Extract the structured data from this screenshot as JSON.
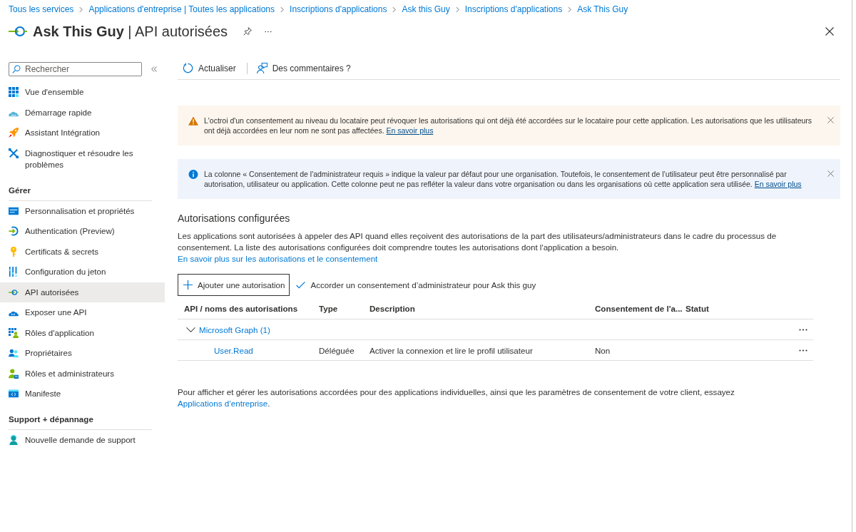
{
  "breadcrumb": [
    {
      "label": "Tous les services"
    },
    {
      "label": "Applications d'entreprise | Toutes les applications"
    },
    {
      "label": "Inscriptions d'applications"
    },
    {
      "label": "Ask this Guy"
    },
    {
      "label": "Inscriptions d'applications"
    },
    {
      "label": "Ask This Guy"
    }
  ],
  "header": {
    "title": "**Ask This Guy** | API autorisées"
  },
  "sidebar": {
    "search": {
      "placeholder": "Rechercher"
    },
    "sections": [
      {
        "items": [
          {
            "kind": "overview",
            "label": "Vue d'ensemble",
            "selected": false
          },
          {
            "kind": "quickstart",
            "label": "Démarrage rapide",
            "selected": false
          },
          {
            "kind": "integration",
            "label": "Assistant Intégration",
            "selected": false
          },
          {
            "kind": "diagnose",
            "label": "Diagnostiquer et résoudre les problèmes",
            "selected": false
          }
        ]
      },
      {
        "heading": "Gérer",
        "items": [
          {
            "kind": "branding",
            "label": "Personnalisation et propriétés",
            "selected": false
          },
          {
            "kind": "authentication",
            "label": "Authentication (Preview)",
            "selected": false
          },
          {
            "kind": "certificates",
            "label": "Certificats & secrets",
            "selected": false
          },
          {
            "kind": "token",
            "label": "Configuration du jeton",
            "selected": false
          },
          {
            "kind": "api",
            "label": "API autorisées",
            "selected": true
          },
          {
            "kind": "expose",
            "label": "Exposer une API",
            "selected": false
          },
          {
            "kind": "app-roles",
            "label": "Rôles d'application",
            "selected": false
          },
          {
            "kind": "owners",
            "label": "Propriétaires",
            "selected": false
          },
          {
            "kind": "roles",
            "label": "Rôles et administrateurs",
            "selected": false
          },
          {
            "kind": "manifest",
            "label": "Manifeste",
            "selected": false
          }
        ]
      },
      {
        "heading": "Support + dépannage",
        "items": [
          {
            "kind": "support",
            "label": "Nouvelle demande de support",
            "selected": false
          }
        ]
      }
    ]
  },
  "toolbar": [
    {
      "kind": "refresh",
      "label": "Actualiser"
    },
    {
      "kind": "feedback",
      "label": "Des commentaires ?"
    }
  ],
  "banners": [
    {
      "kind": "warning",
      "text": "L'octroi d'un consentement au niveau du locataire peut révoquer les autorisations qui ont déjà été accordées sur le locataire pour cette application. Les autorisations que les utilisateurs ont déjà accordées en leur nom ne sont pas affectées.",
      "link": "En savoir plus"
    },
    {
      "kind": "info",
      "text": "La colonne « Consentement de l'administrateur requis » indique la valeur par défaut pour une organisation. Toutefois, le consentement de l’utilisateur peut être personnalisé par autorisation, utilisateur ou application. Cette colonne peut ne pas refléter la valeur dans votre organisation ou dans les organisations où cette application sera utilisée.",
      "link": "En savoir plus"
    }
  ],
  "configured": {
    "title": "Autorisations configurées",
    "description": "Les applications sont autorisées à appeler des API quand elles reçoivent des autorisations de la part des utilisateurs/administrateurs dans le cadre du processus de consentement. La liste des autorisations configurées doit comprendre toutes les autorisations dont l'application a besoin.",
    "link": "En savoir plus sur les autorisations et le consentement"
  },
  "actions": [
    {
      "kind": "add",
      "label": "Ajouter une autorisation"
    },
    {
      "kind": "grant",
      "label": "Accorder un consentement d’administrateur pour Ask this guy"
    }
  ],
  "table": {
    "columns": [
      "API / noms des autorisations",
      "Type",
      "Description",
      "Consentement de l'a...",
      "Statut"
    ],
    "groups": [
      {
        "name": "Microsoft Graph (1)",
        "expanded": true,
        "rows": [
          {
            "cells": [
              "User.Read",
              "Déléguée",
              "Activer la connexion et lire le profil utilisateur",
              "Non"
            ]
          }
        ]
      }
    ]
  },
  "footer": {
    "text": "Pour afficher et gérer les autorisations accordées pour des applications individuelles, ainsi que les paramètres de consentement de votre client, essayez",
    "link": "Applications d’entreprise",
    "end": "."
  }
}
